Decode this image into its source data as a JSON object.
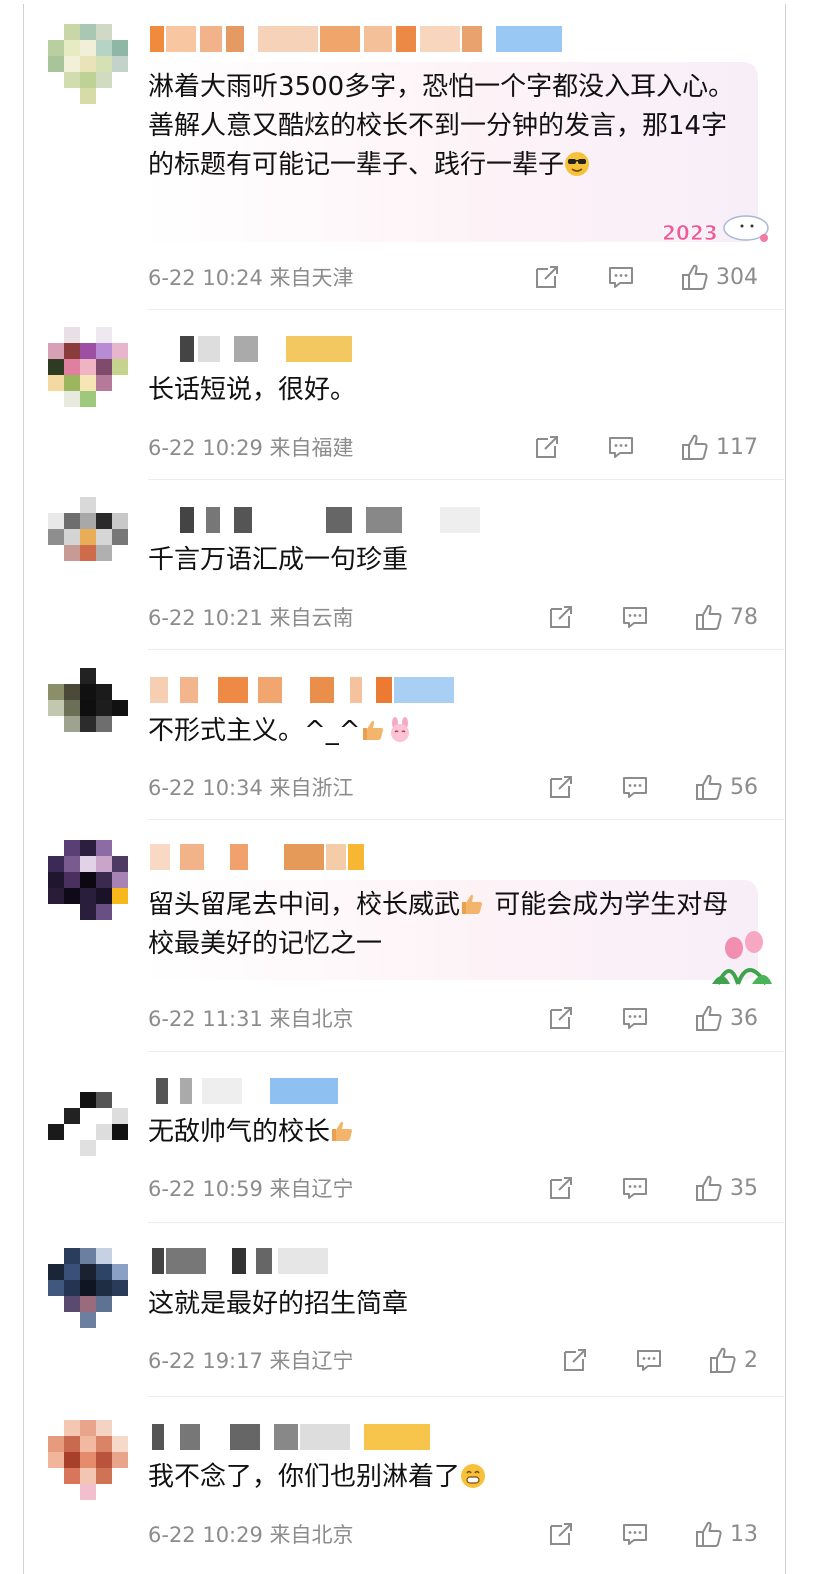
{
  "comments": [
    {
      "text": "淋着大雨听3500多字，恐怕一个字都没入耳入心。善解人意又酷炫的校长不到一分钟的发言，那14字的标题有可能记一辈子、践行一辈子",
      "emoji": "cool-face",
      "meta": "6-22 10:24 来自天津",
      "likes": "304",
      "bubble": true,
      "bubble_sticker": "2023"
    },
    {
      "text": "长话短说，很好。",
      "meta": "6-22 10:29 来自福建",
      "likes": "117"
    },
    {
      "text": "千言万语汇成一句珍重",
      "meta": "6-22 10:21 来自云南",
      "likes": "78"
    },
    {
      "text": "不形式主义。^_^",
      "emoji": "thumbs-up,bunny-face",
      "meta": "6-22 10:34 来自浙江",
      "likes": "56"
    },
    {
      "text_a": "留头留尾去中间，校长威武",
      "text_b": " 可能会成为学生对母校最美好的记忆之一",
      "emoji": "thumbs-up",
      "meta": "6-22 11:31 来自北京",
      "likes": "36",
      "bubble": true
    },
    {
      "text": "无敌帅气的校长",
      "emoji": "thumbs-up",
      "meta": "6-22 10:59 来自辽宁",
      "likes": "35"
    },
    {
      "text": "这就是最好的招生简章",
      "meta": "6-22 19:17 来自辽宁",
      "likes": "2"
    },
    {
      "text": "我不念了，你们也别淋着了",
      "emoji": "grin-face",
      "meta": "6-22 10:29 来自北京",
      "likes": "13"
    }
  ],
  "colors": {
    "meta": "#8c8c8c",
    "text": "#111111",
    "divider": "#ececec"
  }
}
